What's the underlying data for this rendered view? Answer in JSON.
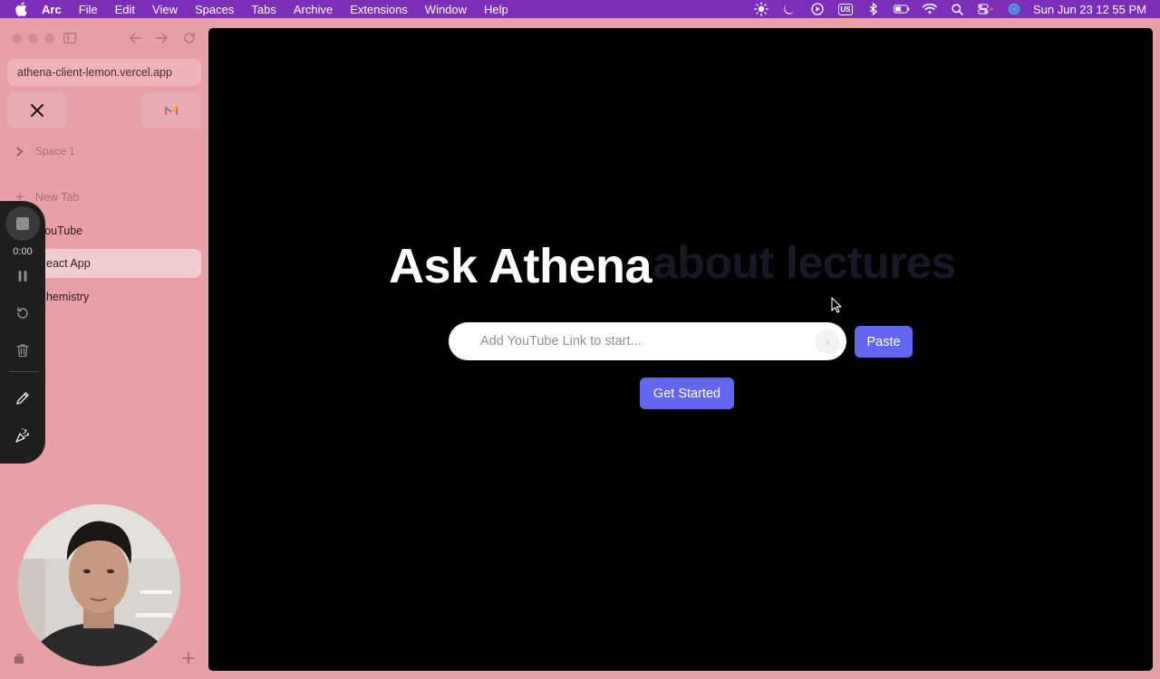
{
  "menubar": {
    "apple_icon": "apple-icon",
    "app_name": "Arc",
    "items": [
      "File",
      "Edit",
      "View",
      "Spaces",
      "Tabs",
      "Archive",
      "Extensions",
      "Window",
      "Help"
    ],
    "status_icons": [
      "brightness-icon",
      "moon-icon",
      "play-circle-icon",
      "keyboard-layout-icon",
      "bluetooth-icon",
      "battery-icon",
      "wifi-icon",
      "search-icon",
      "control-center-icon",
      "siri-icon"
    ],
    "keyboard_label": "US",
    "clock": "Sun Jun 23  12 55 PM",
    "background": "#7b2fb8"
  },
  "sidebar": {
    "url": "athena-client-lemon.vercel.app",
    "pinned": [
      {
        "name": "x-icon",
        "label": "X"
      },
      {
        "name": "gmail-icon",
        "label": "M"
      }
    ],
    "space_label": "Space 1",
    "new_tab_label": "New Tab",
    "tabs": [
      {
        "label": "YouTube"
      },
      {
        "label": "React App",
        "active": true
      },
      {
        "label": "Chemistry"
      }
    ],
    "background": "#e7a0a6"
  },
  "recorder": {
    "timer": "0:00",
    "buttons": [
      "stop-icon",
      "pause-icon",
      "restart-icon",
      "trash-icon",
      "pencil-icon",
      "effects-icon"
    ]
  },
  "main": {
    "headline": "Ask Athena",
    "headline_faded": "about lectures",
    "input_placeholder": "Add YouTube Link to start...",
    "go_arrow": "›",
    "paste_label": "Paste",
    "start_label": "Get Started",
    "accent": "#6366f1"
  }
}
